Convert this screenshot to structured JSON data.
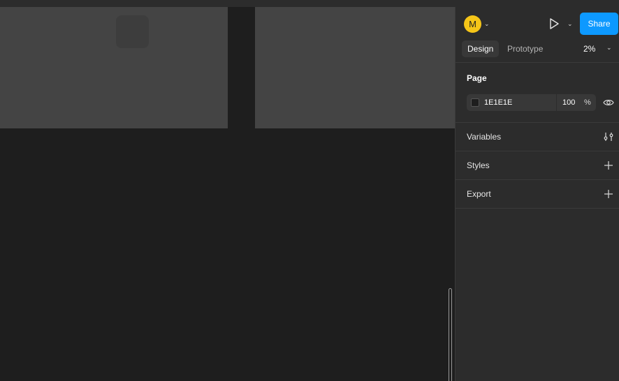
{
  "user": {
    "avatar_initial": "M"
  },
  "toolbar": {
    "share_label": "Share"
  },
  "tabs": [
    {
      "label": "Design"
    },
    {
      "label": "Prototype"
    }
  ],
  "zoom": "2%",
  "page_section": {
    "title": "Page",
    "fill_hex": "1E1E1E",
    "opacity": "100",
    "opacity_unit": "%"
  },
  "sections": {
    "variables": "Variables",
    "styles": "Styles",
    "export": "Export"
  },
  "colors": {
    "canvas_bg": "#1e1e1e",
    "panel_bg": "#2c2c2c",
    "frame_fill": "#444444",
    "accent": "#0d99ff",
    "avatar": "#f5c518"
  },
  "icons": {
    "avatar_chevron": "chevron-down-icon",
    "play": "play-icon",
    "play_chevron": "chevron-down-icon",
    "zoom_chevron": "chevron-down-icon",
    "visibility": "eye-icon",
    "variables": "sliders-icon",
    "styles_add": "plus-icon",
    "export_add": "plus-icon"
  }
}
